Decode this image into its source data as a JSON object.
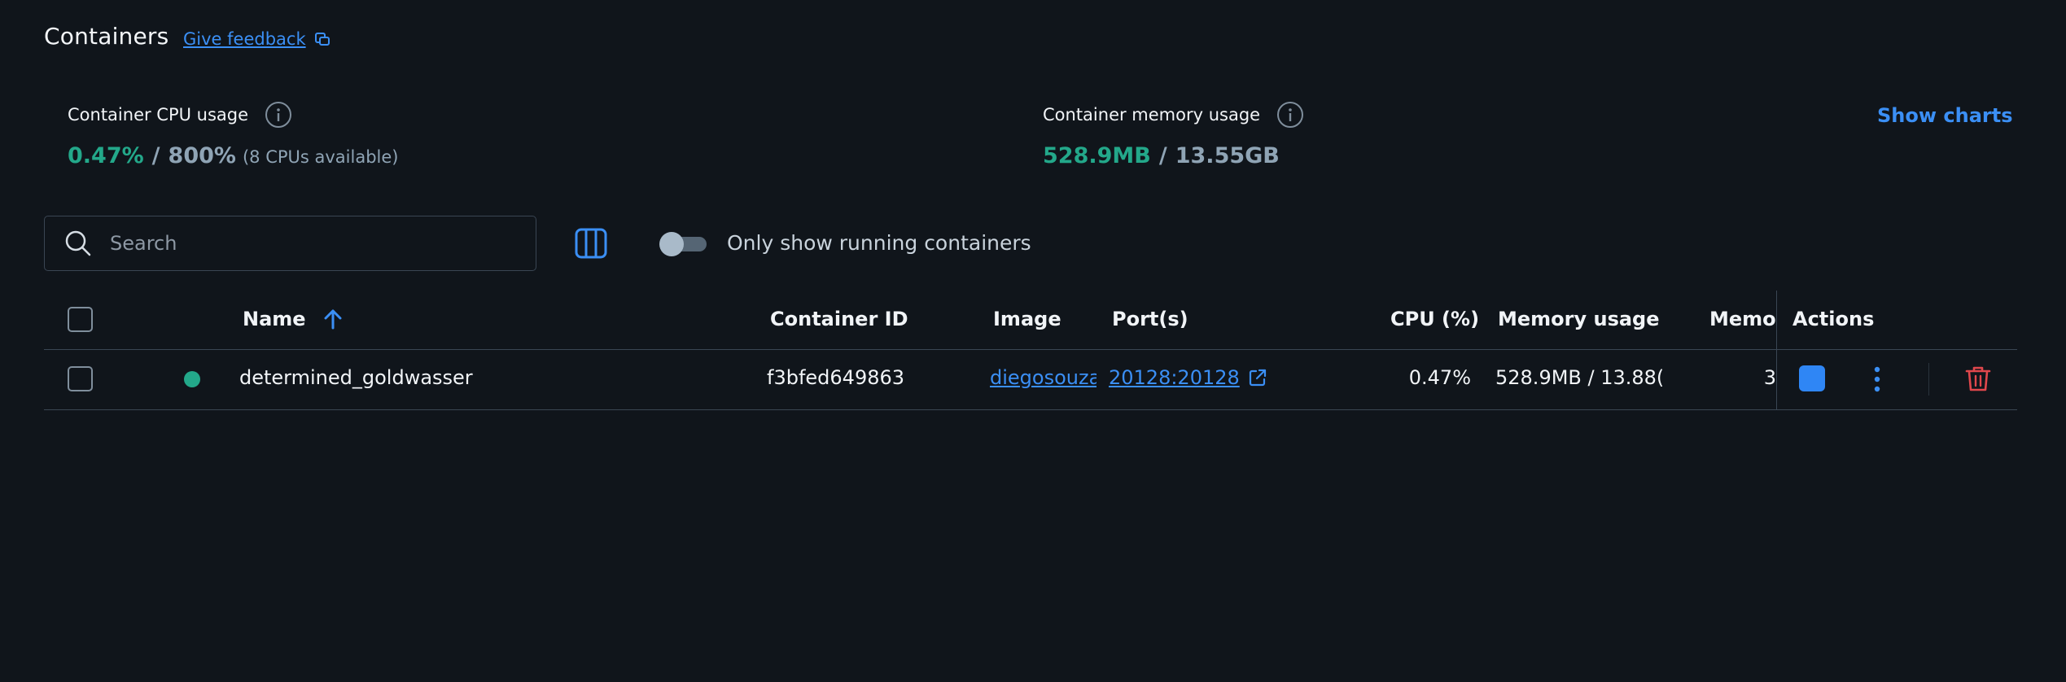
{
  "header": {
    "title": "Containers",
    "feedback_label": "Give feedback"
  },
  "stats": {
    "cpu": {
      "label": "Container CPU usage",
      "value": "0.47%",
      "separator": "/",
      "total": "800%",
      "note": "(8 CPUs available)"
    },
    "memory": {
      "label": "Container memory usage",
      "value": "528.9MB",
      "separator": "/",
      "total": "13.55GB"
    },
    "show_charts_label": "Show charts"
  },
  "toolbar": {
    "search_placeholder": "Search",
    "search_value": "",
    "toggle_label": "Only show running containers",
    "toggle_on": false
  },
  "table": {
    "columns": {
      "name": "Name",
      "container_id": "Container ID",
      "image": "Image",
      "ports": "Port(s)",
      "cpu": "CPU (%)",
      "memory_usage": "Memory usage…",
      "memory_percent": "Memor",
      "actions": "Actions"
    },
    "sort": {
      "column": "Name",
      "direction": "ascending"
    },
    "rows": [
      {
        "status": "running",
        "name": "determined_goldwasser",
        "container_id": "f3bfed649863",
        "image": "diegosouza",
        "ports": "20128:20128",
        "cpu": "0.47%",
        "memory_usage": "528.9MB / 13.88(",
        "memory_percent": "3"
      }
    ]
  },
  "colors": {
    "background": "#10151b",
    "accent": "#3b8ff5",
    "running": "#23a88a",
    "danger": "#e0474c"
  }
}
